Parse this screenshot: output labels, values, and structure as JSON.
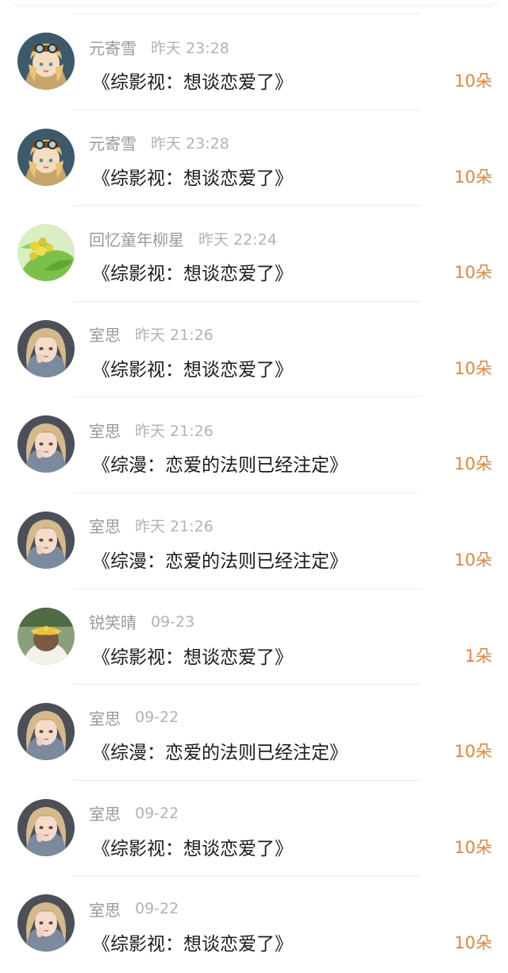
{
  "colors": {
    "amount": "#f08234",
    "name": "#9a9a9a",
    "time": "#b3b3b3",
    "title": "#1c1c1c"
  },
  "items": [
    {
      "name": "元寄雪",
      "time": "昨天 23:28",
      "title": "《综影视：想谈恋爱了》",
      "amount": "10朵",
      "avatar": "anime-girl-goggles-avatar"
    },
    {
      "name": "元寄雪",
      "time": "昨天 23:28",
      "title": "《综影视：想谈恋爱了》",
      "amount": "10朵",
      "avatar": "anime-girl-goggles-avatar"
    },
    {
      "name": "回忆童年柳星",
      "time": "昨天 22:24",
      "title": "《综影视：想谈恋爱了》",
      "amount": "10朵",
      "avatar": "green-fruit-avatar"
    },
    {
      "name": "室思",
      "time": "昨天 21:26",
      "title": "《综影视：想谈恋爱了》",
      "amount": "10朵",
      "avatar": "blonde-girl-avatar"
    },
    {
      "name": "室思",
      "time": "昨天 21:26",
      "title": "《综漫：恋爱的法则已经注定》",
      "amount": "10朵",
      "avatar": "blonde-girl-avatar"
    },
    {
      "name": "室思",
      "time": "昨天 21:26",
      "title": "《综漫：恋爱的法则已经注定》",
      "amount": "10朵",
      "avatar": "blonde-girl-avatar"
    },
    {
      "name": "锐笑晴",
      "time": "09-23",
      "title": "《综影视：想谈恋爱了》",
      "amount": "1朵",
      "avatar": "girl-flower-crown-avatar"
    },
    {
      "name": "室思",
      "time": "09-22",
      "title": "《综漫：恋爱的法则已经注定》",
      "amount": "10朵",
      "avatar": "blonde-girl-avatar"
    },
    {
      "name": "室思",
      "time": "09-22",
      "title": "《综影视：想谈恋爱了》",
      "amount": "10朵",
      "avatar": "blonde-girl-avatar"
    },
    {
      "name": "室思",
      "time": "09-22",
      "title": "《综影视：想谈恋爱了》",
      "amount": "10朵",
      "avatar": "blonde-girl-avatar"
    }
  ]
}
